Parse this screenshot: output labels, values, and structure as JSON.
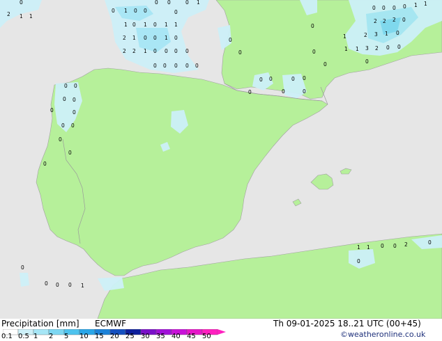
{
  "title": {
    "product": "Precipitation [mm]",
    "model": "ECMWF"
  },
  "valid_time": "Th 09-01-2025 18..21 UTC (00+45)",
  "credit": "©weatheronline.co.uk",
  "legend": {
    "ticks": [
      "0.1",
      "0.5",
      "1",
      "2",
      "5",
      "10",
      "15",
      "20",
      "25",
      "30",
      "35",
      "40",
      "45",
      "50"
    ],
    "colors": [
      "#ffffff",
      "#cdf0f8",
      "#a6e6f6",
      "#7dd7f2",
      "#4fc3ee",
      "#2aa6e8",
      "#1c82d8",
      "#1550c0",
      "#0e1f9c",
      "#7a10c8",
      "#a010d8",
      "#c812d8",
      "#e616c8",
      "#ff20c0"
    ]
  },
  "colors": {
    "land": "#b6f09a",
    "sea": "#e6e6e6",
    "precip_light": "#cdf0f8",
    "precip_mid": "#a6e6f6",
    "precip_high": "#7dd7f2"
  },
  "point_values": [
    {
      "id": "p1",
      "v": "0"
    },
    {
      "id": "p2",
      "v": "2"
    },
    {
      "id": "p3",
      "v": "1"
    },
    {
      "id": "p4",
      "v": "1"
    },
    {
      "id": "p5",
      "v": "0"
    },
    {
      "id": "p6",
      "v": "1"
    },
    {
      "id": "p7",
      "v": "0"
    },
    {
      "id": "p8",
      "v": "0"
    },
    {
      "id": "p9",
      "v": "0"
    },
    {
      "id": "p10",
      "v": "1"
    },
    {
      "id": "p11",
      "v": "0"
    },
    {
      "id": "p12",
      "v": "1"
    },
    {
      "id": "p13",
      "v": "0"
    },
    {
      "id": "p14",
      "v": "1"
    },
    {
      "id": "p15",
      "v": "1"
    },
    {
      "id": "p16",
      "v": "2"
    },
    {
      "id": "p17",
      "v": "1"
    },
    {
      "id": "p18",
      "v": "0"
    },
    {
      "id": "p19",
      "v": "0"
    },
    {
      "id": "p20",
      "v": "1"
    },
    {
      "id": "p21",
      "v": "0"
    },
    {
      "id": "p22",
      "v": "2"
    },
    {
      "id": "p23",
      "v": "2"
    },
    {
      "id": "p24",
      "v": "1"
    },
    {
      "id": "p25",
      "v": "0"
    },
    {
      "id": "p26",
      "v": "0"
    },
    {
      "id": "p27",
      "v": "0"
    },
    {
      "id": "p28",
      "v": "0"
    },
    {
      "id": "p29",
      "v": "0"
    },
    {
      "id": "p30",
      "v": "0"
    },
    {
      "id": "p31",
      "v": "0"
    },
    {
      "id": "p32",
      "v": "0"
    },
    {
      "id": "p33",
      "v": "0"
    },
    {
      "id": "p34",
      "v": "0"
    },
    {
      "id": "p35",
      "v": "0"
    },
    {
      "id": "p36",
      "v": "0"
    },
    {
      "id": "p37",
      "v": "1"
    },
    {
      "id": "p38",
      "v": "0"
    },
    {
      "id": "p39",
      "v": "0"
    },
    {
      "id": "p40",
      "v": "0"
    },
    {
      "id": "p41",
      "v": "0"
    },
    {
      "id": "p42",
      "v": "1"
    },
    {
      "id": "p43",
      "v": "1"
    },
    {
      "id": "p44",
      "v": "2"
    },
    {
      "id": "p45",
      "v": "2"
    },
    {
      "id": "p46",
      "v": "2"
    },
    {
      "id": "p47",
      "v": "0"
    },
    {
      "id": "p48",
      "v": "2"
    },
    {
      "id": "p49",
      "v": "3"
    },
    {
      "id": "p50",
      "v": "1"
    },
    {
      "id": "p51",
      "v": "0"
    },
    {
      "id": "p52",
      "v": "1"
    },
    {
      "id": "p53",
      "v": "3"
    },
    {
      "id": "p54",
      "v": "2"
    },
    {
      "id": "p55",
      "v": "0"
    },
    {
      "id": "p56",
      "v": "0"
    },
    {
      "id": "p57",
      "v": "0"
    },
    {
      "id": "p58",
      "v": "1"
    },
    {
      "id": "p59",
      "v": "0"
    },
    {
      "id": "p60",
      "v": "1"
    },
    {
      "id": "p61",
      "v": "0"
    },
    {
      "id": "p62",
      "v": "0"
    },
    {
      "id": "p63",
      "v": "0"
    },
    {
      "id": "p64",
      "v": "0"
    },
    {
      "id": "p65",
      "v": "0"
    },
    {
      "id": "p66",
      "v": "0"
    },
    {
      "id": "p67",
      "v": "0"
    },
    {
      "id": "p68",
      "v": "0"
    },
    {
      "id": "p69",
      "v": "0"
    },
    {
      "id": "p70",
      "v": "0"
    },
    {
      "id": "p71",
      "v": "0"
    },
    {
      "id": "p72",
      "v": "0"
    },
    {
      "id": "p73",
      "v": "0"
    },
    {
      "id": "p74",
      "v": "0"
    },
    {
      "id": "p75",
      "v": "0"
    },
    {
      "id": "p76",
      "v": "0"
    },
    {
      "id": "p77",
      "v": "0"
    },
    {
      "id": "p78",
      "v": "0"
    },
    {
      "id": "p79",
      "v": "0"
    },
    {
      "id": "p80",
      "v": "0"
    },
    {
      "id": "p81",
      "v": "0"
    },
    {
      "id": "p82",
      "v": "0"
    },
    {
      "id": "p83",
      "v": "1"
    },
    {
      "id": "p84",
      "v": "1"
    },
    {
      "id": "p85",
      "v": "0"
    },
    {
      "id": "p86",
      "v": "0"
    },
    {
      "id": "p87",
      "v": "2"
    },
    {
      "id": "p88",
      "v": "0"
    },
    {
      "id": "p89",
      "v": "0"
    },
    {
      "id": "p90",
      "v": "0"
    },
    {
      "id": "p91",
      "v": "0"
    },
    {
      "id": "p92",
      "v": "0"
    },
    {
      "id": "p93",
      "v": "0"
    },
    {
      "id": "p94",
      "v": "1"
    }
  ]
}
